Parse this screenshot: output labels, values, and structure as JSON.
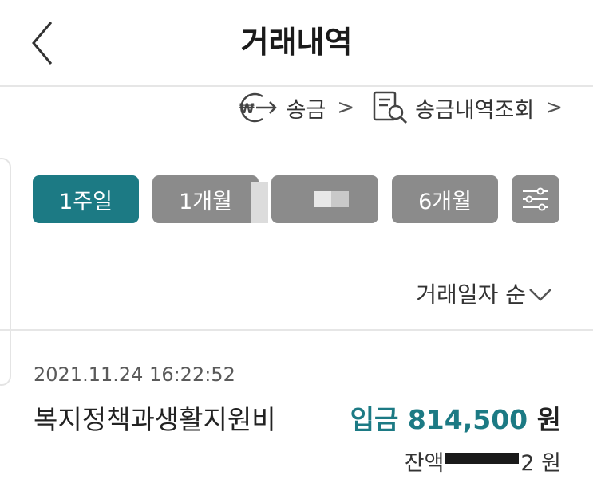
{
  "header": {
    "title": "거래내역"
  },
  "links": {
    "transfer_label": "송금",
    "history_label": "송금내역조회"
  },
  "periods": [
    {
      "label": "1주일",
      "active": true
    },
    {
      "label": "1개월",
      "active": false
    },
    {
      "label": "6개월",
      "active": false
    }
  ],
  "sort": {
    "label": "거래일자 순"
  },
  "transactions": [
    {
      "datetime": "2021.11.24 16:22:52",
      "description": "복지정책과생활지원비",
      "type": "입금",
      "amount": "814,500",
      "unit": "원",
      "balance_label": "잔액",
      "balance_visible_suffix": "2",
      "balance_unit": "원"
    }
  ],
  "colors": {
    "accent": "#1c7a84",
    "button_gray": "#8b8b8b"
  }
}
